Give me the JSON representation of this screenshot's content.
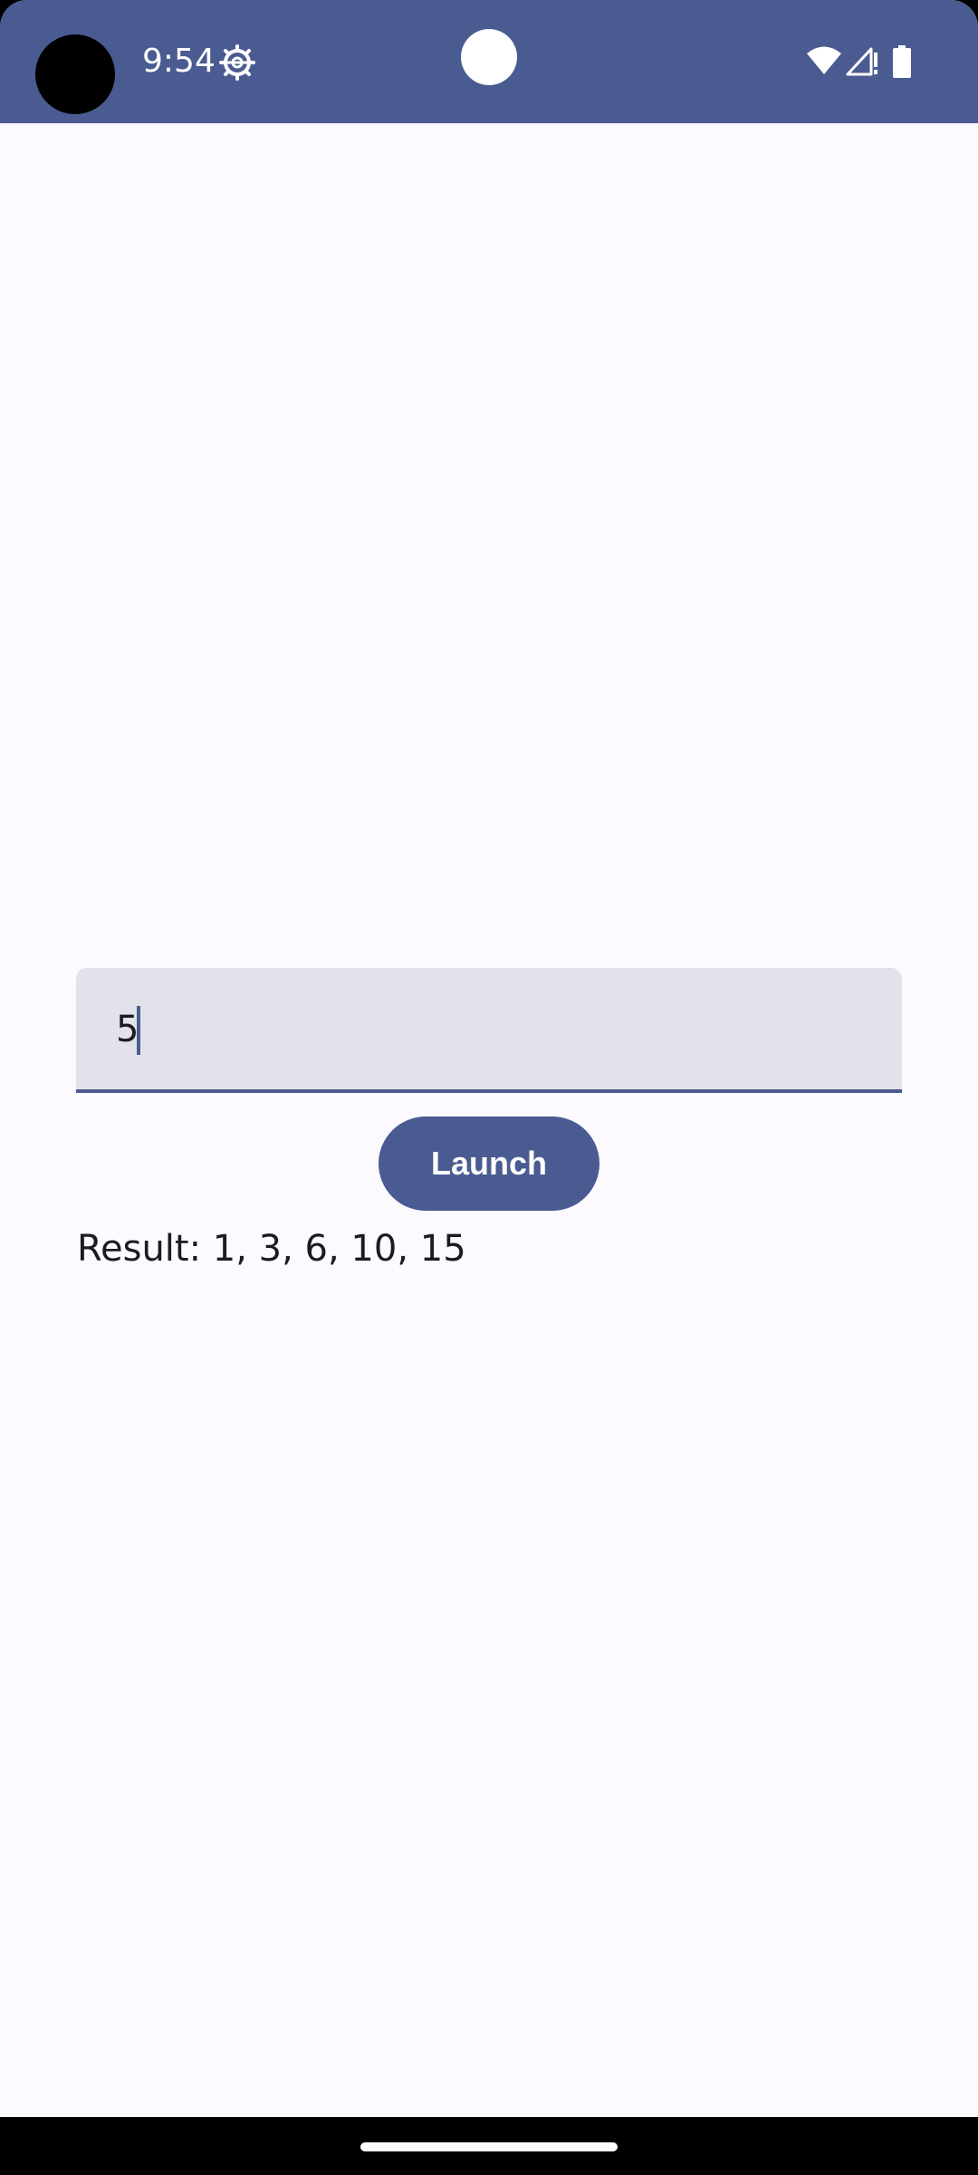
{
  "status_bar": {
    "time": "9:54",
    "icons": [
      "settings-icon",
      "wifi-icon",
      "signal-icon",
      "battery-icon"
    ],
    "color": "#4a5b91"
  },
  "form": {
    "input_value": "5",
    "button_label": "Launch",
    "result_text": "Result: 1, 3, 6, 10, 15"
  },
  "colors": {
    "accent": "#4a5b91",
    "background": "#fcfaff",
    "field_background": "#e2e2ea",
    "text": "#1b1b21"
  }
}
